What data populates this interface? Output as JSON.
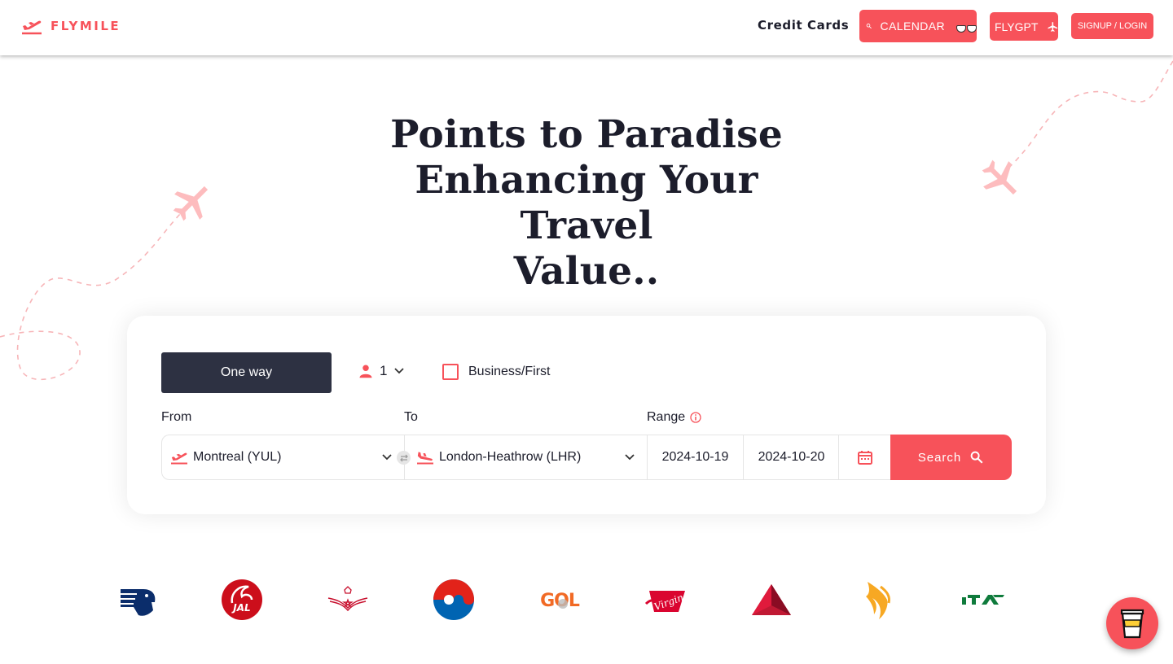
{
  "nav": {
    "brand_name": "FLYMILE",
    "credit_cards": "Credit Cards",
    "calendar_label": "CALENDAR",
    "flygpt_label": "FLYGPT",
    "login_label": "SIGNUP / LOGIN"
  },
  "hero": {
    "line1": "Points to Paradise",
    "line2": "Enhancing Your Travel",
    "line3": "Value.."
  },
  "search": {
    "trip_type": "One way",
    "passengers": "1",
    "cabin_label": "Business/First",
    "cabin_checked": false,
    "from_label": "From",
    "to_label": "To",
    "range_label": "Range",
    "from_value": "Montreal (YUL)",
    "to_value": "London-Heathrow (LHR)",
    "date_start": "2024-10-19",
    "date_end": "2024-10-20",
    "search_label": "Search"
  },
  "airline_logos": [
    "aeromexico-logo",
    "jal-logo",
    "royal-air-maroc-logo",
    "korean-air-logo",
    "gol-logo",
    "virgin-atlantic-logo",
    "delta-logo",
    "singapore-airlines-logo",
    "ita-airways-logo"
  ],
  "logo_text": {
    "jal": "JAL",
    "gol": "GOL",
    "virgin": "Virgin"
  },
  "colors": {
    "accent": "#f7525a",
    "dark": "#2d3142",
    "text": "#1c1d2b"
  }
}
